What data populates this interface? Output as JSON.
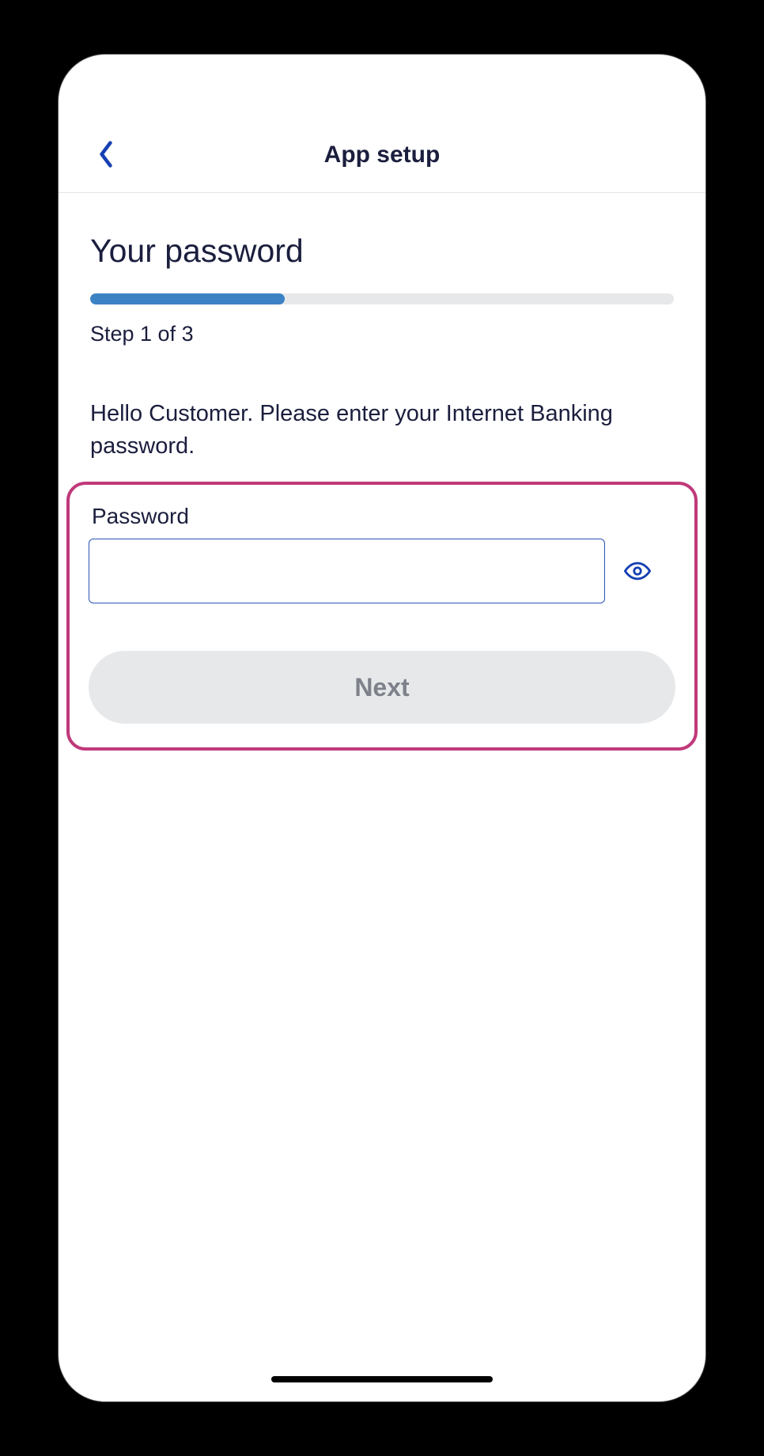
{
  "header": {
    "title": "App setup"
  },
  "page": {
    "title": "Your password",
    "step_text": "Step 1 of 3",
    "progress_percent": 33.3,
    "instruction": "Hello Customer. Please enter your Internet Banking password."
  },
  "form": {
    "password_label": "Password",
    "password_value": "",
    "next_label": "Next"
  },
  "icons": {
    "back": "back-chevron",
    "eye": "show-password"
  }
}
